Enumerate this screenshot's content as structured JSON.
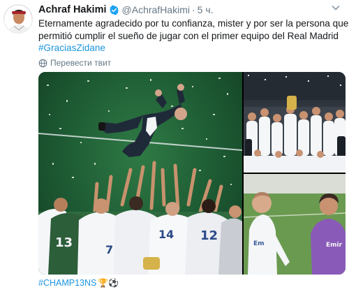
{
  "tweet": {
    "author_name": "Achraf Hakimi",
    "author_handle": "@AchrafHakimi",
    "separator": "·",
    "timestamp": "5 ч.",
    "text_lines": [
      "Eternamente agradecido por tu confianza, mister y por ser la persona que me",
      "permitió cumplir el sueño de jugar con el primer equipo del Real Madrid"
    ],
    "hashtag": "#GraciasZidane",
    "translate_label": "Перевести твит",
    "footer_hashtag": "#CHAMP13NS",
    "footer_emojis": "🏆⚽",
    "verified": true
  },
  "colors": {
    "link": "#1b95e0",
    "muted": "#657786",
    "text": "#14171a",
    "verified_badge": "#1da1f2"
  },
  "icons": {
    "verified": "verified-badge-icon",
    "more": "chevron-down-icon",
    "translate": "globe-icon"
  },
  "media": {
    "images": [
      {
        "name": "celebration-photo",
        "content": "players tossing coach in the air"
      },
      {
        "name": "team-photo",
        "content": "team celebrating with trophy"
      },
      {
        "name": "training-photo",
        "content": "coach and player on training pitch"
      }
    ]
  }
}
